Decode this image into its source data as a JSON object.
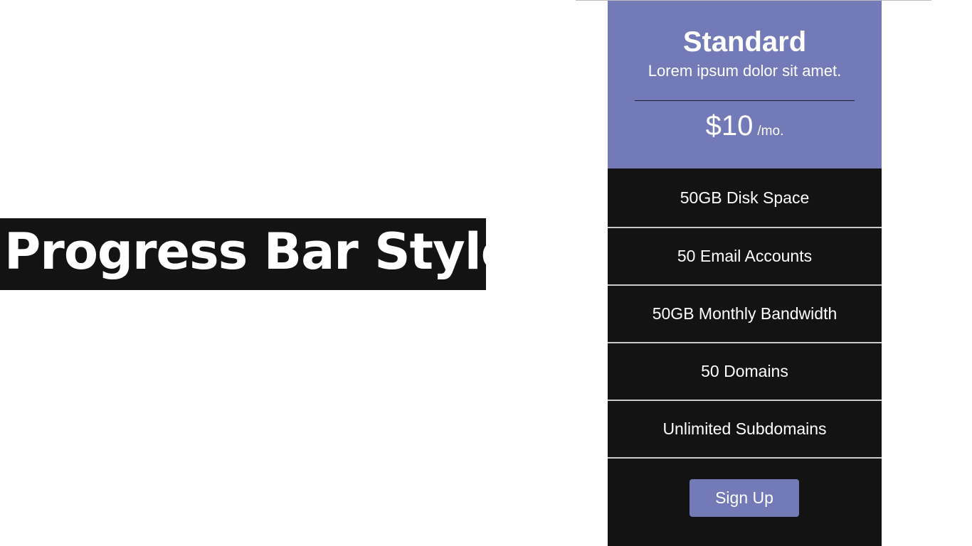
{
  "banner": {
    "title": "Progress Bar Styles"
  },
  "pricing_card": {
    "plan_name": "Standard",
    "description": "Lorem ipsum dolor sit amet.",
    "price": "$10",
    "period": "/mo.",
    "features": [
      "50GB Disk Space",
      "50 Email Accounts",
      "50GB Monthly Bandwidth",
      "50 Domains",
      "Unlimited Subdomains"
    ],
    "signup_label": "Sign Up"
  },
  "colors": {
    "accent": "#727ab7",
    "card_body": "#131313",
    "banner_background": "#131313",
    "divider": "#c9c9c9"
  }
}
